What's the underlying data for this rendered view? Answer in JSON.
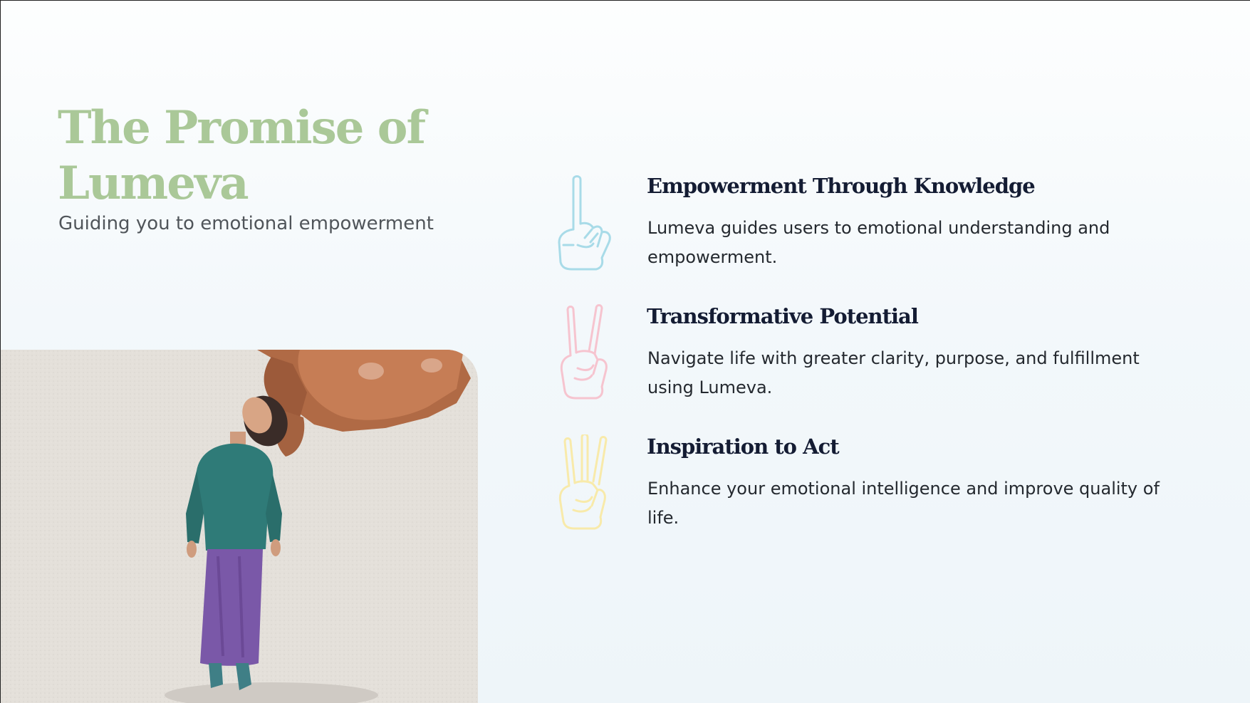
{
  "header": {
    "title": "The Promise of Lumeva",
    "subtitle": "Guiding you to emotional empowerment"
  },
  "illustration": {
    "description_icon": "woman-lifted-by-hand-illustration"
  },
  "features": [
    {
      "icon": "one-finger-hand-icon",
      "icon_color": "#a8dbe8",
      "title": "Empowerment Through Knowledge",
      "body": "Lumeva guides users to emotional understanding and empowerment."
    },
    {
      "icon": "two-finger-hand-icon",
      "icon_color": "#f6c4cf",
      "title": "Transformative Potential",
      "body": "Navigate life with greater clarity, purpose, and fulfillment using Lumeva."
    },
    {
      "icon": "three-finger-hand-icon",
      "icon_color": "#f8eaaa",
      "title": "Inspiration to Act",
      "body": "Enhance your emotional intelligence and improve quality of life."
    }
  ],
  "colors": {
    "title": "#aac898",
    "heading": "#141c33",
    "body": "#24292f"
  }
}
